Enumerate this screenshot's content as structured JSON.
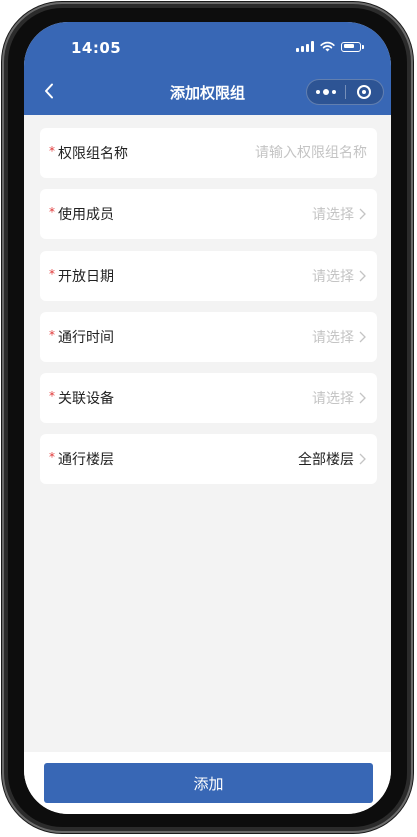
{
  "status_bar": {
    "time": "14:05"
  },
  "nav": {
    "title": "添加权限组",
    "back_icon": "chevron-left-icon",
    "menu_icon": "more-dots-icon",
    "close_icon": "target-circle-icon"
  },
  "form": {
    "rows": [
      {
        "label": "权限组名称",
        "required": true,
        "type": "input",
        "value": "",
        "placeholder": "请输入权限组名称"
      },
      {
        "label": "使用成员",
        "required": true,
        "type": "select",
        "value": "请选择"
      },
      {
        "label": "开放日期",
        "required": true,
        "type": "select",
        "value": "请选择"
      },
      {
        "label": "通行时间",
        "required": true,
        "type": "select",
        "value": "请选择"
      },
      {
        "label": "关联设备",
        "required": true,
        "type": "select",
        "value": "请选择"
      },
      {
        "label": "通行楼层",
        "required": true,
        "type": "select",
        "value": "全部楼层"
      }
    ]
  },
  "footer": {
    "submit_label": "添加"
  },
  "colors": {
    "primary": "#3867b5",
    "required": "#e03a3a",
    "placeholder": "#c4c4c4",
    "background": "#f3f3f3"
  }
}
